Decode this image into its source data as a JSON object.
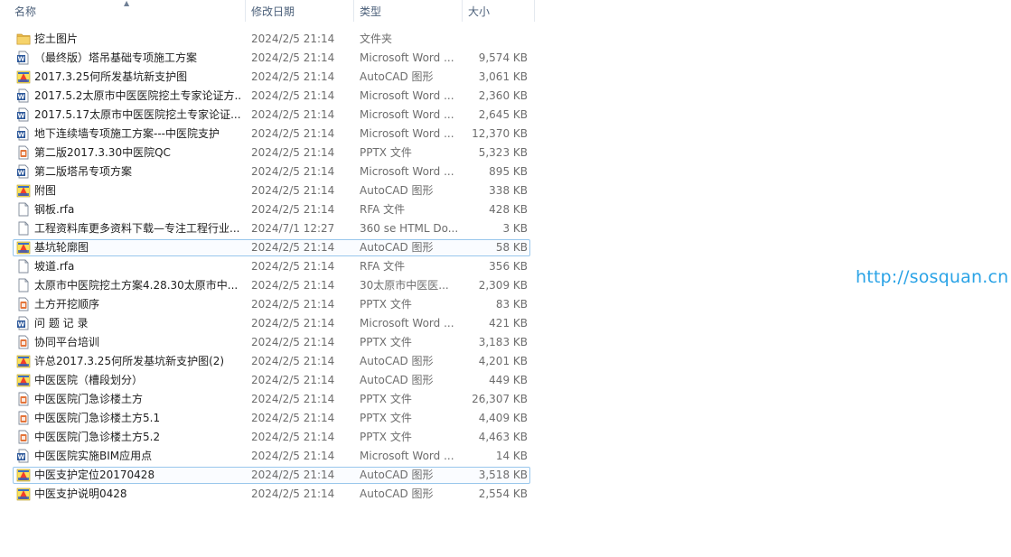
{
  "columns": {
    "name": "名称",
    "date": "修改日期",
    "type": "类型",
    "size": "大小"
  },
  "files": [
    {
      "icon": "folder-icon",
      "name": "挖土图片",
      "date": "2024/2/5 21:14",
      "type": "文件夹",
      "size": ""
    },
    {
      "icon": "word-doc-icon",
      "name": "（最终版）塔吊基础专项施工方案",
      "date": "2024/2/5 21:14",
      "type": "Microsoft Word ...",
      "size": "9,574 KB"
    },
    {
      "icon": "autocad-icon",
      "name": "2017.3.25何所发基坑新支护图",
      "date": "2024/2/5 21:14",
      "type": "AutoCAD 图形",
      "size": "3,061 KB"
    },
    {
      "icon": "word-doc-icon",
      "name": "2017.5.2太原市中医医院挖土专家论证方...",
      "date": "2024/2/5 21:14",
      "type": "Microsoft Word ...",
      "size": "2,360 KB"
    },
    {
      "icon": "word-doc-icon",
      "name": "2017.5.17太原市中医医院挖土专家论证...",
      "date": "2024/2/5 21:14",
      "type": "Microsoft Word ...",
      "size": "2,645 KB"
    },
    {
      "icon": "word-doc-icon",
      "name": "地下连续墙专项施工方案---中医院支护",
      "date": "2024/2/5 21:14",
      "type": "Microsoft Word ...",
      "size": "12,370 KB"
    },
    {
      "icon": "pptx-icon",
      "name": "第二版2017.3.30中医院QC",
      "date": "2024/2/5 21:14",
      "type": "PPTX 文件",
      "size": "5,323 KB"
    },
    {
      "icon": "word-doc-icon",
      "name": "第二版塔吊专项方案",
      "date": "2024/2/5 21:14",
      "type": "Microsoft Word ...",
      "size": "895 KB"
    },
    {
      "icon": "autocad-icon",
      "name": "附图",
      "date": "2024/2/5 21:14",
      "type": "AutoCAD 图形",
      "size": "338 KB"
    },
    {
      "icon": "blank-file-icon",
      "name": "钢板.rfa",
      "date": "2024/2/5 21:14",
      "type": "RFA 文件",
      "size": "428 KB"
    },
    {
      "icon": "blank-file-icon",
      "name": "工程资料库更多资料下载—专注工程行业...",
      "date": "2024/7/1 12:27",
      "type": "360 se HTML Do...",
      "size": "3 KB"
    },
    {
      "icon": "autocad-icon",
      "name": "基坑轮廓图",
      "date": "2024/2/5 21:14",
      "type": "AutoCAD 图形",
      "size": "58 KB",
      "selected": true
    },
    {
      "icon": "blank-file-icon",
      "name": "坡道.rfa",
      "date": "2024/2/5 21:14",
      "type": "RFA 文件",
      "size": "356 KB"
    },
    {
      "icon": "blank-file-icon",
      "name": "太原市中医院挖土方案4.28.30太原市中...",
      "date": "2024/2/5 21:14",
      "type": "30太原市中医医...",
      "size": "2,309 KB"
    },
    {
      "icon": "pptx-icon",
      "name": "土方开挖顺序",
      "date": "2024/2/5 21:14",
      "type": "PPTX 文件",
      "size": "83 KB"
    },
    {
      "icon": "word-doc-icon",
      "name": "问 题 记 录",
      "date": "2024/2/5 21:14",
      "type": "Microsoft Word ...",
      "size": "421 KB"
    },
    {
      "icon": "pptx-icon",
      "name": "协同平台培训",
      "date": "2024/2/5 21:14",
      "type": "PPTX 文件",
      "size": "3,183 KB"
    },
    {
      "icon": "autocad-icon",
      "name": "许总2017.3.25何所发基坑新支护图(2)",
      "date": "2024/2/5 21:14",
      "type": "AutoCAD 图形",
      "size": "4,201 KB"
    },
    {
      "icon": "autocad-icon",
      "name": "中医医院（槽段划分）",
      "date": "2024/2/5 21:14",
      "type": "AutoCAD 图形",
      "size": "449 KB"
    },
    {
      "icon": "pptx-icon",
      "name": "中医医院门急诊楼土方",
      "date": "2024/2/5 21:14",
      "type": "PPTX 文件",
      "size": "26,307 KB"
    },
    {
      "icon": "pptx-icon",
      "name": "中医医院门急诊楼土方5.1",
      "date": "2024/2/5 21:14",
      "type": "PPTX 文件",
      "size": "4,409 KB"
    },
    {
      "icon": "pptx-icon",
      "name": "中医医院门急诊楼土方5.2",
      "date": "2024/2/5 21:14",
      "type": "PPTX 文件",
      "size": "4,463 KB"
    },
    {
      "icon": "word-doc-icon",
      "name": "中医医院实施BIM应用点",
      "date": "2024/2/5 21:14",
      "type": "Microsoft Word ...",
      "size": "14 KB"
    },
    {
      "icon": "autocad-icon",
      "name": "中医支护定位20170428",
      "date": "2024/2/5 21:14",
      "type": "AutoCAD 图形",
      "size": "3,518 KB",
      "selected": true
    },
    {
      "icon": "autocad-icon",
      "name": "中医支护说明0428",
      "date": "2024/2/5 21:14",
      "type": "AutoCAD 图形",
      "size": "2,554 KB"
    }
  ],
  "watermark": "http://sosquan.cn"
}
